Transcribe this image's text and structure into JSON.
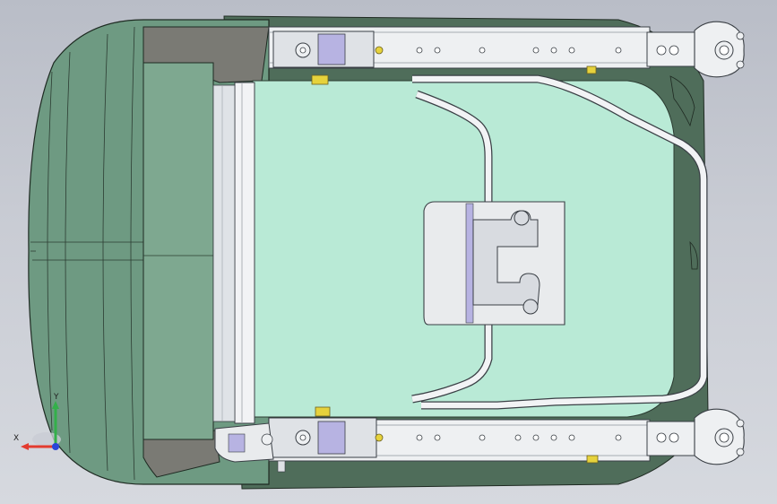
{
  "viewport": {
    "background_top": "#b9bdc7",
    "background_bottom": "#d6d9df",
    "model_name": "seat-frame-assembly-top-view"
  },
  "colors": {
    "cushion": "#6e9a82",
    "cushion_dark": "#4e7460",
    "cushion_panel": "#7ea890",
    "pan": "#b9ead6",
    "rail": "#eef0f2",
    "rail_edge": "#5a5f66",
    "tube": "#f2f3f5",
    "bracket": "#e9ebed",
    "lilac": "#b7b3e2",
    "bolt": "#e6d23c",
    "shadow_panel": "#7a7a74"
  },
  "triad": {
    "x_label": "X",
    "y_label": "Y",
    "x_color": "#e33b2f",
    "y_color": "#33b04a",
    "z_color": "#2b45d8"
  }
}
